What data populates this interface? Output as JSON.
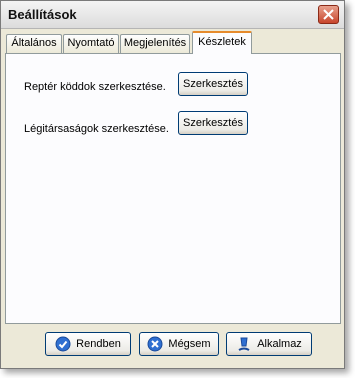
{
  "window": {
    "title": "Beállítások"
  },
  "tabs": [
    {
      "label": "Általános"
    },
    {
      "label": "Nyomtató"
    },
    {
      "label": "Megjelenítés"
    },
    {
      "label": "Készletek",
      "active": true
    }
  ],
  "panel": {
    "rows": [
      {
        "label": "Reptér köddok szerkesztése.",
        "button": "Szerkesztés"
      },
      {
        "label": "Légitársaságok szerkesztése.",
        "button": "Szerkesztés"
      }
    ]
  },
  "footer": {
    "ok": "Rendben",
    "cancel": "Mégsem",
    "apply": "Alkalmaz"
  },
  "colors": {
    "tab_accent": "#e68b2c",
    "button_border": "#003c74",
    "close": "#c8452c"
  }
}
